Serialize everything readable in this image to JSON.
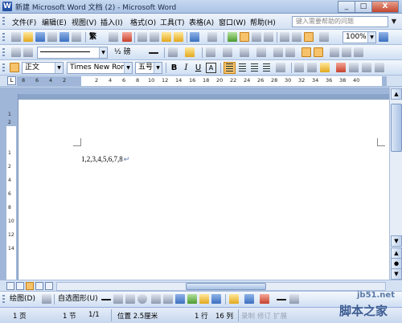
{
  "window": {
    "title": "新建 Microsoft Word 文档 (2) - Microsoft Word",
    "minimize_label": "_",
    "maximize_label": "□",
    "close_label": "X"
  },
  "menu": {
    "items": [
      "文件(F)",
      "编辑(E)",
      "视图(V)",
      "插入(I)",
      "格式(O)",
      "工具(T)",
      "表格(A)",
      "窗口(W)",
      "帮助(H)"
    ],
    "help_placeholder": "键入需要帮助的问题"
  },
  "standard_toolbar": {
    "traditional_label": "繁",
    "zoom": "100%"
  },
  "drawing_format_toolbar": {
    "line_weight": "½ 磅"
  },
  "formatting_toolbar": {
    "style": "正文",
    "font": "Times New Roman",
    "size": "五号",
    "bold": "B",
    "italic": "I",
    "underline": "U",
    "char_border": "A"
  },
  "ruler": {
    "tab_stop_glyph": "L",
    "numbers": [
      "8",
      "6",
      "4",
      "2",
      "2",
      "4",
      "6",
      "8",
      "10",
      "12",
      "14",
      "16",
      "18",
      "20",
      "22",
      "24",
      "26",
      "28",
      "30",
      "32",
      "34",
      "36",
      "38",
      "40"
    ],
    "vertical_numbers": [
      "1",
      "2",
      "1",
      "2",
      "4",
      "6",
      "8",
      "10",
      "12",
      "14"
    ]
  },
  "document": {
    "text": "1,2,3,4,5,6,7,8",
    "paragraph_mark": "↵"
  },
  "drawing_toolbar": {
    "draw_label": "绘图(D)",
    "autoshapes_label": "自选图形(U)"
  },
  "status_bar": {
    "page": "1 页",
    "section": "1 节",
    "page_of": "1/1",
    "position": "位置 2.5厘米",
    "line": "1 行",
    "column": "16 列",
    "record": "录制",
    "revision": "修订",
    "extend": "扩展"
  },
  "watermark": {
    "site": "jb51.net",
    "name": "脚本之家"
  },
  "colors": {
    "accent": "#f6c26b",
    "chrome": "#d4e1f3",
    "page_bg": "#9fb6d8"
  }
}
